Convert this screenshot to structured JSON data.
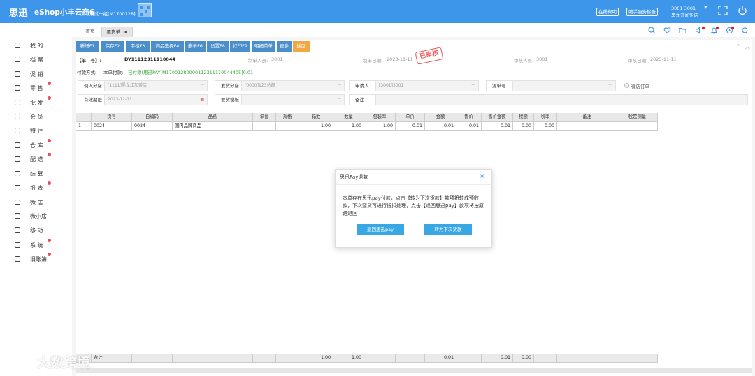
{
  "app": {
    "logo_text": "思迅",
    "name": "eShop小丰云商6",
    "account": "测试一组[M1700128]",
    "online_help": "在线帮助",
    "assistant": "助手服务检查",
    "user_id": "3001 3001",
    "store": "黑龙江加盟店"
  },
  "sidebar": {
    "items": [
      {
        "label": "我 的",
        "icon": "user-icon",
        "dot": false
      },
      {
        "label": "档 案",
        "icon": "book-icon",
        "dot": false
      },
      {
        "label": "促 销",
        "icon": "promo-icon",
        "dot": false
      },
      {
        "label": "零 售",
        "icon": "bag-icon",
        "dot": true
      },
      {
        "label": "批 发",
        "icon": "tag-icon",
        "dot": true
      },
      {
        "label": "会 员",
        "icon": "member-icon",
        "dot": false
      },
      {
        "label": "特 往",
        "icon": "target-icon",
        "dot": false
      },
      {
        "label": "仓 库",
        "icon": "warehouse-icon",
        "dot": true
      },
      {
        "label": "配 送",
        "icon": "truck-icon",
        "dot": true
      },
      {
        "label": "结 算",
        "icon": "settle-icon",
        "dot": false
      },
      {
        "label": "报 表",
        "icon": "report-icon",
        "dot": true
      },
      {
        "label": "微 店",
        "icon": "shop-icon",
        "dot": false
      },
      {
        "label": "微小店",
        "icon": "store-icon",
        "dot": false
      },
      {
        "label": "移 动",
        "icon": "mobile-icon",
        "dot": false
      },
      {
        "label": "系 统",
        "icon": "settings-icon",
        "dot": true
      },
      {
        "label": "旧账簿",
        "icon": "ledger-icon",
        "dot": true
      }
    ]
  },
  "tabs": {
    "home": "首页",
    "active": "要货单",
    "close": "×"
  },
  "toolbar": [
    "新增F1",
    "保存F2",
    "审核F3",
    "商品选择F4",
    "删单F6",
    "设置F8",
    "打印F9",
    "明细菜单",
    "更多",
    "返回"
  ],
  "header": {
    "order_no_label": "【单　号】:",
    "order_no": "DY11112311110044",
    "maker_label": "制单人员:",
    "maker": "3001",
    "make_date_label": "制单日期:",
    "make_date": "2023-11-11",
    "approver_label": "审核人员:",
    "approver": "3001",
    "approve_date_label": "审核日期:",
    "approve_date": "2023-11-11",
    "stamp": "已审核",
    "payment_label": "付款方式:",
    "payment_prefix": "本单付款:",
    "payment_detail": "已付款(思迅PAY[M17001280000112311110044405]0.01"
  },
  "form": {
    "branch_in_label": "调入分店",
    "branch_in": "[1111]黑龙江加盟店",
    "branch_out_label": "发货分店",
    "branch_out": "[0000]123总部",
    "applicant_label": "申请人",
    "applicant": "[3001]3001",
    "source_label": "源单号",
    "source": "",
    "micro_order": "微店订单",
    "expiry_label": "有效期限",
    "expiry": "2023-12-11",
    "template_label": "要货模板",
    "template": "",
    "remark_label": "备注",
    "remark": ""
  },
  "table": {
    "columns": [
      "",
      "货号",
      "自编码",
      "品名",
      "单位",
      "规格",
      "箱数",
      "数量",
      "包装率",
      "单价",
      "金额",
      "售价",
      "售价金额",
      "税额",
      "税率",
      "备注",
      "税是测量"
    ],
    "rows": [
      [
        "1",
        "0024",
        "0024",
        "国内品牌商品",
        "",
        "",
        "1.00",
        "1.00",
        "1.00",
        "0.01",
        "0.01",
        "0.01",
        "0.01",
        "0.00",
        "0.00",
        "",
        ""
      ]
    ],
    "total": [
      "",
      "合计",
      "",
      "",
      "",
      "",
      "1.00",
      "1.00",
      "",
      "",
      "0.01",
      "",
      "0.01",
      "0.00",
      "",
      "",
      ""
    ]
  },
  "modal": {
    "title": "思迅Pay退款",
    "close": "×",
    "body": "本单存在思迅pay付款，点击【转为下次货款】款项将转成预收款，下次要货可进行抵扣处理，点击【退回思迅pay】款项将按原路退回",
    "btn_refund": "退回思迅pay",
    "btn_next": "转为下次货款"
  },
  "watermark": "大数跨境"
}
